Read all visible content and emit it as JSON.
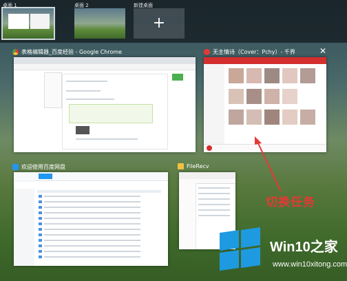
{
  "desktops": {
    "items": [
      {
        "label": "桌面 1",
        "active": true
      },
      {
        "label": "桌面 2",
        "active": false
      }
    ],
    "new_label": "新建桌面",
    "new_icon": "plus-icon"
  },
  "windows": {
    "chrome": {
      "title": "表格编辑器_百度经验 - Google Chrome",
      "icon": "chrome-icon"
    },
    "music": {
      "title": "无主情诗（Cover：Pchy）- 千界",
      "icon": "music-app-icon"
    },
    "baidupan": {
      "title": "欢迎使用百度网盘",
      "icon": "cloud-icon"
    },
    "filerecv": {
      "title": "FileRecv",
      "icon": "folder-icon"
    }
  },
  "annotation": {
    "text": "切换任务",
    "color": "#e53935"
  },
  "brand": {
    "name": "Win10",
    "suffix": "之家",
    "url": "www.win10xitong.com",
    "logo_color": "#1e9ae0"
  }
}
